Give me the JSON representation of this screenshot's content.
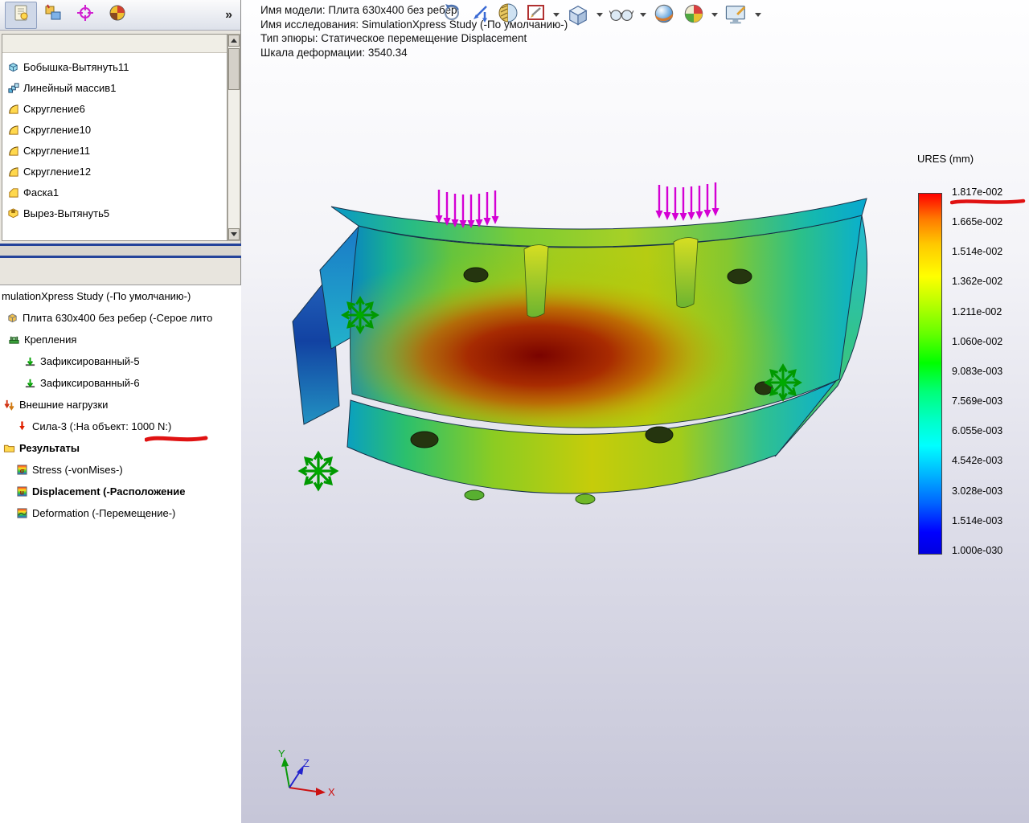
{
  "colors": {
    "annotation_red": "#e01212",
    "legend_top": "#ff0000",
    "legend_bottom": "#0000e0"
  },
  "sidebar": {
    "expand_label": "»",
    "tabs": [
      "property-manager-tab-icon",
      "configuration-manager-tab-icon",
      "dimxpert-manager-tab-icon",
      "display-manager-tab-icon"
    ],
    "feature_tree": {
      "items": [
        {
          "label": "Бобышка-Вытянуть11",
          "icon": "boss-extrude-icon"
        },
        {
          "label": "Линейный массив1",
          "icon": "linear-pattern-icon"
        },
        {
          "label": "Скругление6",
          "icon": "fillet-icon"
        },
        {
          "label": "Скругление10",
          "icon": "fillet-icon"
        },
        {
          "label": "Скругление11",
          "icon": "fillet-icon"
        },
        {
          "label": "Скругление12",
          "icon": "fillet-icon"
        },
        {
          "label": "Фаска1",
          "icon": "chamfer-icon"
        },
        {
          "label": "Вырез-Вытянуть5",
          "icon": "cut-extrude-icon"
        }
      ]
    },
    "study_tree": {
      "title": "mulationXpress Study (-По умолчанию-)",
      "items": [
        {
          "label": "Плита 630x400 без ребер (-Серое лито",
          "icon": "part-icon"
        },
        {
          "label": "Крепления",
          "icon": "fixtures-folder-icon"
        },
        {
          "label": "Зафиксированный-5",
          "icon": "fixed-geometry-icon"
        },
        {
          "label": "Зафиксированный-6",
          "icon": "fixed-geometry-icon"
        },
        {
          "label": "Внешние нагрузки",
          "icon": "external-loads-folder-icon"
        },
        {
          "label": "Сила-3 (:На объект: 1000 N:)",
          "icon": "force-icon",
          "annotation": "red-underline"
        },
        {
          "label": "Результаты",
          "icon": "results-folder-icon",
          "bold": true
        },
        {
          "label": "Stress (-vonMises-)",
          "icon": "stress-plot-icon"
        },
        {
          "label": "Displacement (-Расположение",
          "icon": "displacement-plot-icon",
          "bold": true
        },
        {
          "label": "Deformation (-Перемещение-)",
          "icon": "deformation-plot-icon"
        }
      ]
    }
  },
  "viewport": {
    "header": {
      "model_line": "Имя модели: Плита 630x400 без ребер",
      "study_line": "Имя  исследования: SimulationXpress Study (-По умолчанию-)",
      "plot_line": "Тип эпюры: Статическое перемещение Displacement",
      "scale_line": "Шкала деформации: 3540.34"
    },
    "toolbar_icons": [
      "rotate-view-icon",
      "previous-view-icon",
      "section-view-icon",
      "edit-sketch-icon",
      "view-orientation-icon",
      "hide-show-items-icon",
      "edit-appearance-icon",
      "apply-scene-icon",
      "view-settings-icon"
    ],
    "triad": {
      "x_label": "X",
      "y_label": "Y",
      "z_label": "Z"
    }
  },
  "legend": {
    "title": "URES (mm)",
    "values": [
      "1.817e-002",
      "1.665e-002",
      "1.514e-002",
      "1.362e-002",
      "1.211e-002",
      "1.060e-002",
      "9.083e-003",
      "7.569e-003",
      "6.055e-003",
      "4.542e-003",
      "3.028e-003",
      "1.514e-003",
      "1.000e-030"
    ]
  }
}
